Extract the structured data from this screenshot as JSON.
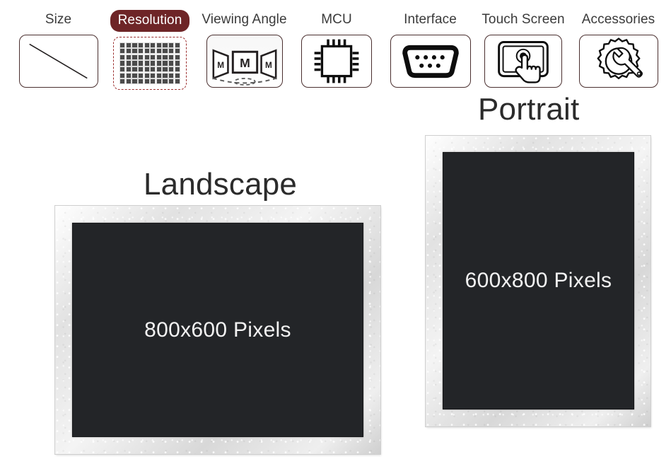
{
  "categories": [
    {
      "label": "Size",
      "icon": "diagonal-size-icon",
      "active": false
    },
    {
      "label": "Resolution",
      "icon": "pixel-grid-icon",
      "active": true
    },
    {
      "label": "Viewing Angle",
      "icon": "viewing-angle-icon",
      "active": false
    },
    {
      "label": "MCU",
      "icon": "microchip-icon",
      "active": false
    },
    {
      "label": "Interface",
      "icon": "db9-connector-icon",
      "active": false
    },
    {
      "label": "Touch Screen",
      "icon": "touch-hand-icon",
      "active": false
    },
    {
      "label": "Accessories",
      "icon": "gear-wrench-icon",
      "active": false
    }
  ],
  "panels": {
    "landscape": {
      "title": "Landscape",
      "resolution": "800x600 Pixels"
    },
    "portrait": {
      "title": "Portrait",
      "resolution": "600x800 Pixels"
    }
  },
  "colors": {
    "accent": "#6e2527",
    "accent_dashed_border": "#9c2f2f",
    "screen": "#232528",
    "label_text": "#3a3a3a",
    "title_text": "#2b2b2b",
    "bezel_light": "#f4f4f4",
    "bezel_dark": "#cfcfcf"
  },
  "resolution_icon_grid": {
    "columns": 10,
    "rows": 7
  }
}
